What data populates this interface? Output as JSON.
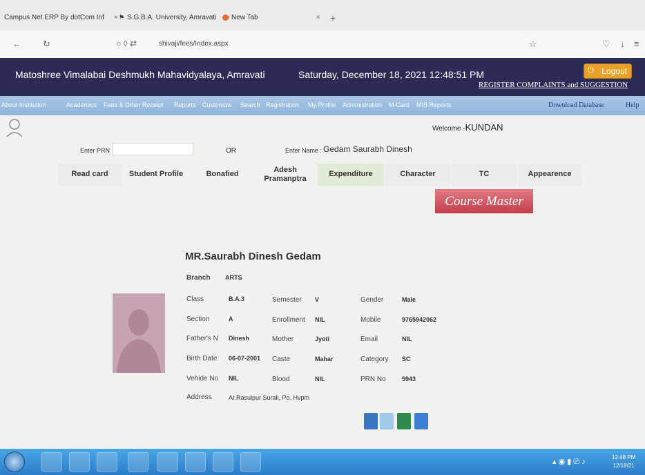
{
  "browser": {
    "tabs": [
      {
        "label": "Campus Net ERP By dotCom Inf",
        "close": "×"
      },
      {
        "label": "S.G.B.A. University, Amravati",
        "close": "×"
      },
      {
        "label": "New Tab",
        "close": "×"
      }
    ],
    "new_tab": "+",
    "url": "shivaji/fees/Index.aspx"
  },
  "header": {
    "college": "Matoshree Vimalabai Deshmukh Mahavidyalaya, Amravati",
    "datetime": "Saturday, December 18, 2021 12:48:51 PM",
    "logout": "Logout",
    "register": "REGISTER COMPLAINTS and SUGGESTION"
  },
  "menu": {
    "items": [
      "About Institution",
      "Academics",
      "Fees & Other Receipt",
      "Reports",
      "Customize",
      "Search",
      "Registration",
      "My Profile",
      "Administration",
      "M-Card",
      "MIS Reports"
    ],
    "download": "Download Database",
    "help": "Help"
  },
  "welcome": {
    "prefix": "Welcome -",
    "user": "KUNDAN"
  },
  "search": {
    "prn_label": "Enter PRN :",
    "prn_value": "",
    "or": "OR",
    "name_label": "Enter Name :",
    "name_value": "Gedam Saurabh Dinesh"
  },
  "actions": [
    "Read card",
    "Student Profile",
    "Bonafied",
    "Adesh Pramanptra",
    "Expenditure",
    "Character",
    "TC",
    "Appearence"
  ],
  "course_master": "Course Master",
  "profile": {
    "name": "MR.Saurabh Dinesh Gedam",
    "branch_label": "Branch",
    "branch": "ARTS",
    "fields": {
      "class_l": "Class",
      "class": "B.A.3",
      "semester_l": "Semester",
      "semester": "V",
      "gender_l": "Gender",
      "gender": "Male",
      "section_l": "Section",
      "section": "A",
      "enrollment_l": "Enrollment",
      "enrollment": "NIL",
      "mobile_l": "Mobile",
      "mobile": "9765942062",
      "father_l": "Father's N",
      "father": "Dinesh",
      "mother_l": "Mother",
      "mother": "Jyoti",
      "email_l": "Email",
      "email": "NIL",
      "birth_l": "Birth Date",
      "birth": "06-07-2001",
      "caste_l": "Caste",
      "caste": "Mahar",
      "category_l": "Category",
      "category": "SC",
      "vehicle_l": "Vehide No",
      "vehicle": "NIL",
      "blood_l": "Blood",
      "blood": "NIL",
      "prn_l": "PRN No",
      "prn": "5943",
      "address_l": "Address",
      "address": "At Rasulpur Surali, Po. Hvpm"
    }
  },
  "taskbar": {
    "time": "12:48 PM",
    "date": "12/18/21"
  },
  "colors": {
    "header_bg": "#2c2b55",
    "menu_bg": "#a9c7e6",
    "accent": "#c33f4c",
    "logout": "#e8a22a"
  }
}
